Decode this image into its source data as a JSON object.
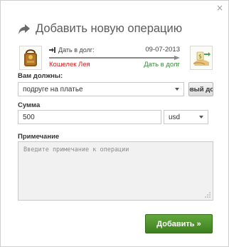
{
  "dialog": {
    "close_label": "×",
    "title": "Добавить новую операцию"
  },
  "operation": {
    "type_label": "Дать в долг:",
    "date": "09-07-2013",
    "from_account": "Кошелек Лея",
    "to_label": "Дать в долг",
    "icons": [
      "purse-icon",
      "lend-money-icon",
      "transfer-arrow-icon"
    ]
  },
  "form": {
    "debtor_label": "Вам должны:",
    "debtor_value": "подруге на платье",
    "new_debt_button": "Новый долг",
    "amount_label": "Сумма",
    "amount_value": "500",
    "currency_value": "usd",
    "note_label": "Примечание",
    "note_placeholder": "Введите примечание к операции",
    "submit_button": "Добавить »"
  },
  "colors": {
    "from_account": "#cc2222",
    "to_label": "#3d8a3d",
    "submit_button": "#4d9229"
  }
}
